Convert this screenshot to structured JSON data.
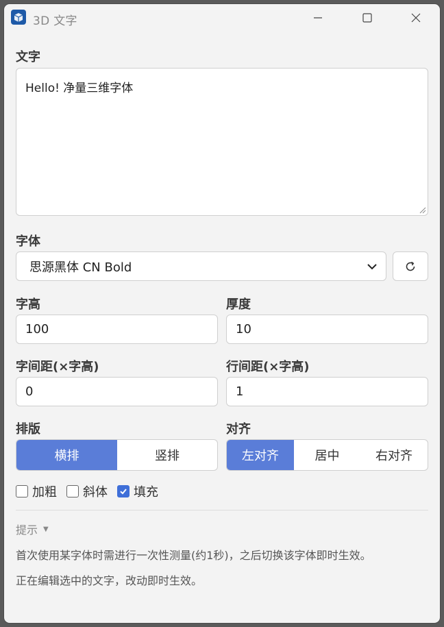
{
  "window": {
    "title": "3D 文字"
  },
  "text_section": {
    "label": "文字",
    "value": "Hello! 净量三维字体"
  },
  "font_section": {
    "label": "字体",
    "selected": "思源黑体 CN Bold"
  },
  "size": {
    "label": "字高",
    "value": "100"
  },
  "thickness": {
    "label": "厚度",
    "value": "10"
  },
  "char_spacing": {
    "label": "字间距(×字高)",
    "value": "0"
  },
  "line_spacing": {
    "label": "行间距(×字高)",
    "value": "1"
  },
  "layout": {
    "label": "排版",
    "options": [
      "横排",
      "竖排"
    ],
    "selected_index": 0
  },
  "align": {
    "label": "对齐",
    "options": [
      "左对齐",
      "居中",
      "右对齐"
    ],
    "selected_index": 0
  },
  "style": {
    "bold": {
      "label": "加粗",
      "checked": false
    },
    "italic": {
      "label": "斜体",
      "checked": false
    },
    "fill": {
      "label": "填充",
      "checked": true
    }
  },
  "hint": {
    "toggle_label": "提示",
    "lines": [
      "首次使用某字体时需进行一次性测量(约1秒)，之后切换该字体即时生效。",
      "正在编辑选中的文字，改动即时生效。"
    ]
  },
  "colors": {
    "accent": "#5a7dd8",
    "checkbox": "#3f6fd8",
    "background": "#f3f3f3"
  },
  "icons": [
    "app-icon",
    "minimize-icon",
    "maximize-icon",
    "close-icon",
    "chevron-down-icon",
    "refresh-icon",
    "checkmark-icon",
    "triangle-down-icon"
  ]
}
